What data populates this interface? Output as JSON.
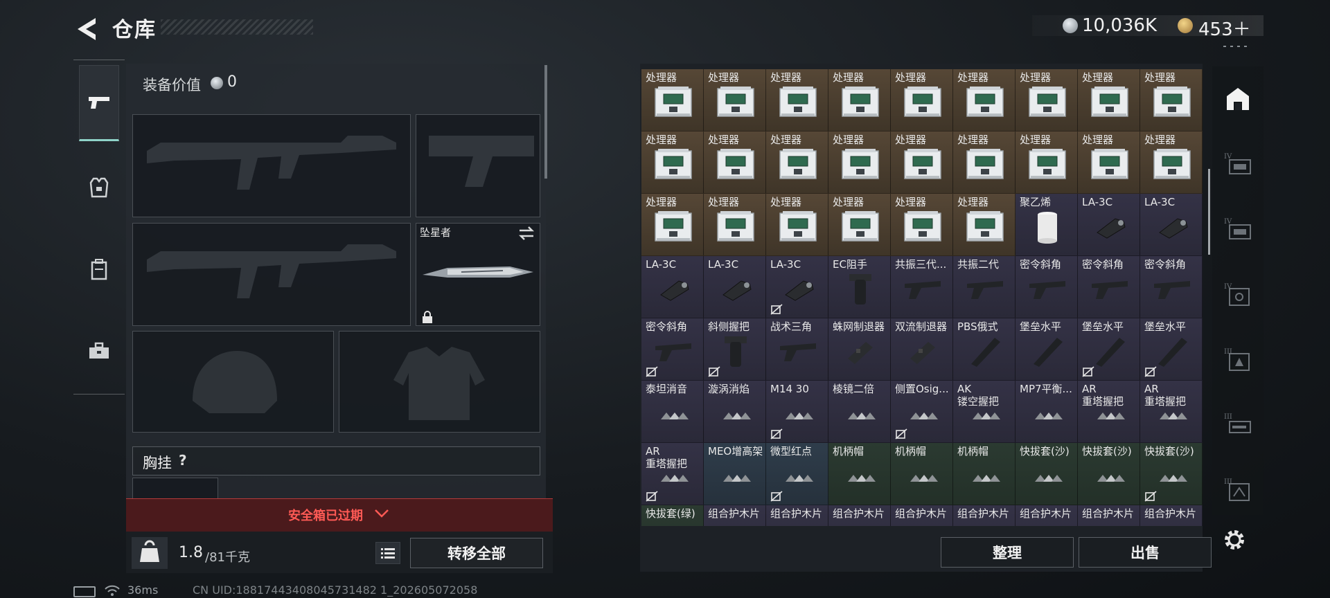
{
  "header": {
    "title": "仓库",
    "currency_a": "10,036K",
    "currency_b": "453＋"
  },
  "equipment": {
    "value_label": "装备价值",
    "value": "0",
    "melee_name": "坠星者",
    "chest_label": "胸挂",
    "chest_help": "?",
    "safebox_text": "安全箱已过期",
    "weight_value": "1.8",
    "weight_max": "/81千克",
    "transfer_all": "转移全部"
  },
  "inventory": {
    "rows": [
      [
        {
          "label": "处理器",
          "color": "brown",
          "icon": "processor-icon",
          "nosell": false
        },
        {
          "label": "处理器",
          "color": "brown",
          "icon": "processor-icon",
          "nosell": false
        },
        {
          "label": "处理器",
          "color": "brown",
          "icon": "processor-icon",
          "nosell": false
        },
        {
          "label": "处理器",
          "color": "brown",
          "icon": "processor-icon",
          "nosell": false
        },
        {
          "label": "处理器",
          "color": "brown",
          "icon": "processor-icon",
          "nosell": false
        },
        {
          "label": "处理器",
          "color": "brown",
          "icon": "processor-icon",
          "nosell": false
        },
        {
          "label": "处理器",
          "color": "brown",
          "icon": "processor-icon",
          "nosell": false
        },
        {
          "label": "处理器",
          "color": "brown",
          "icon": "processor-icon",
          "nosell": false
        },
        {
          "label": "处理器",
          "color": "brown",
          "icon": "processor-icon",
          "nosell": false
        }
      ],
      [
        {
          "label": "处理器",
          "color": "brown",
          "icon": "processor-icon",
          "nosell": false
        },
        {
          "label": "处理器",
          "color": "brown",
          "icon": "processor-icon",
          "nosell": false
        },
        {
          "label": "处理器",
          "color": "brown",
          "icon": "processor-icon",
          "nosell": false
        },
        {
          "label": "处理器",
          "color": "brown",
          "icon": "processor-icon",
          "nosell": false
        },
        {
          "label": "处理器",
          "color": "brown",
          "icon": "processor-icon",
          "nosell": false
        },
        {
          "label": "处理器",
          "color": "brown",
          "icon": "processor-icon",
          "nosell": false
        },
        {
          "label": "处理器",
          "color": "brown",
          "icon": "processor-icon",
          "nosell": false
        },
        {
          "label": "处理器",
          "color": "brown",
          "icon": "processor-icon",
          "nosell": false
        },
        {
          "label": "处理器",
          "color": "brown",
          "icon": "processor-icon",
          "nosell": false
        }
      ],
      [
        {
          "label": "处理器",
          "color": "brown",
          "icon": "processor-icon",
          "nosell": false
        },
        {
          "label": "处理器",
          "color": "brown",
          "icon": "processor-icon",
          "nosell": false
        },
        {
          "label": "处理器",
          "color": "brown",
          "icon": "processor-icon",
          "nosell": false
        },
        {
          "label": "处理器",
          "color": "brown",
          "icon": "processor-icon",
          "nosell": false
        },
        {
          "label": "处理器",
          "color": "brown",
          "icon": "processor-icon",
          "nosell": false
        },
        {
          "label": "处理器",
          "color": "brown",
          "icon": "processor-icon",
          "nosell": false
        },
        {
          "label": "聚乙烯",
          "color": "purple",
          "icon": "polyethylene-roll-icon",
          "nosell": false
        },
        {
          "label": "LA-3C",
          "color": "purple",
          "icon": "flashlight-icon",
          "nosell": false
        },
        {
          "label": "LA-3C",
          "color": "purple",
          "icon": "flashlight-icon",
          "nosell": false
        }
      ],
      [
        {
          "label": "LA-3C",
          "color": "purple",
          "icon": "flashlight-icon",
          "nosell": false
        },
        {
          "label": "LA-3C",
          "color": "purple",
          "icon": "flashlight-icon",
          "nosell": false
        },
        {
          "label": "LA-3C",
          "color": "purple",
          "icon": "flashlight-icon",
          "nosell": true
        },
        {
          "label": "EC阻手",
          "color": "purple",
          "icon": "grip-icon",
          "nosell": false
        },
        {
          "label": "共振三代...",
          "color": "purple",
          "icon": "angled-grip-icon",
          "nosell": false
        },
        {
          "label": "共振二代",
          "color": "purple",
          "icon": "angled-grip-icon",
          "nosell": false
        },
        {
          "label": "密令斜角",
          "color": "purple",
          "icon": "angled-grip-icon",
          "nosell": false
        },
        {
          "label": "密令斜角",
          "color": "purple",
          "icon": "angled-grip-icon",
          "nosell": false
        },
        {
          "label": "密令斜角",
          "color": "purple",
          "icon": "angled-grip-icon",
          "nosell": false
        }
      ],
      [
        {
          "label": "密令斜角",
          "color": "purple",
          "icon": "angled-grip-icon",
          "nosell": true
        },
        {
          "label": "斜侧握把",
          "color": "purple",
          "icon": "grip-icon",
          "nosell": true
        },
        {
          "label": "战术三角",
          "color": "purple",
          "icon": "angled-grip-icon",
          "nosell": false
        },
        {
          "label": "蛛网制退器",
          "color": "purple",
          "icon": "muzzle-brake-icon",
          "nosell": false
        },
        {
          "label": "双流制退器",
          "color": "purple",
          "icon": "muzzle-brake-icon",
          "nosell": false
        },
        {
          "label": "PBS俄式",
          "color": "purple",
          "icon": "suppressor-icon",
          "nosell": false
        },
        {
          "label": "堡垒水平",
          "color": "purple",
          "icon": "suppressor-icon",
          "nosell": false
        },
        {
          "label": "堡垒水平",
          "color": "purple",
          "icon": "suppressor-icon",
          "nosell": true
        },
        {
          "label": "堡垒水平",
          "color": "purple",
          "icon": "suppressor-icon",
          "nosell": true
        }
      ],
      [
        {
          "label": "泰坦消音",
          "color": "purple",
          "icon": "placeholder-triangles-icon",
          "nosell": false
        },
        {
          "label": "漩涡消焰",
          "color": "purple",
          "icon": "placeholder-triangles-icon",
          "nosell": false
        },
        {
          "label": "M14 30",
          "color": "purple",
          "icon": "placeholder-triangles-icon",
          "nosell": true
        },
        {
          "label": "棱镜二倍",
          "color": "purple",
          "icon": "placeholder-triangles-icon",
          "nosell": false
        },
        {
          "label": "侧置Osig...",
          "color": "purple",
          "icon": "placeholder-triangles-icon",
          "nosell": true
        },
        {
          "label": "AK\n镂空握把",
          "color": "purple",
          "icon": "placeholder-triangles-icon",
          "nosell": false
        },
        {
          "label": "MP7平衡...",
          "color": "purple",
          "icon": "placeholder-triangles-icon",
          "nosell": false
        },
        {
          "label": "AR\n重塔握把",
          "color": "purple",
          "icon": "placeholder-triangles-icon",
          "nosell": false
        },
        {
          "label": "AR\n重塔握把",
          "color": "purple",
          "icon": "placeholder-triangles-icon",
          "nosell": false
        }
      ],
      [
        {
          "label": "AR\n重塔握把",
          "color": "purple",
          "icon": "placeholder-triangles-icon",
          "nosell": true
        },
        {
          "label": "MEO增高架",
          "color": "blue",
          "icon": "placeholder-triangles-icon",
          "nosell": false
        },
        {
          "label": "微型红点",
          "color": "blue",
          "icon": "placeholder-triangles-icon",
          "nosell": true
        },
        {
          "label": "机柄帽",
          "color": "green",
          "icon": "placeholder-triangles-icon",
          "nosell": false
        },
        {
          "label": "机柄帽",
          "color": "green",
          "icon": "placeholder-triangles-icon",
          "nosell": false
        },
        {
          "label": "机柄帽",
          "color": "green",
          "icon": "placeholder-triangles-icon",
          "nosell": false
        },
        {
          "label": "快拔套(沙)",
          "color": "green",
          "icon": "placeholder-triangles-icon",
          "nosell": false
        },
        {
          "label": "快拔套(沙)",
          "color": "green",
          "icon": "placeholder-triangles-icon",
          "nosell": false
        },
        {
          "label": "快拔套(沙)",
          "color": "green",
          "icon": "placeholder-triangles-icon",
          "nosell": true
        }
      ],
      [
        {
          "label": "快拔套(绿)",
          "color": "green",
          "icon": "placeholder-triangles-icon",
          "nosell": false
        },
        {
          "label": "组合护木片",
          "color": "purple",
          "icon": "placeholder-triangles-icon",
          "nosell": false
        },
        {
          "label": "组合护木片",
          "color": "purple",
          "icon": "placeholder-triangles-icon",
          "nosell": false
        },
        {
          "label": "组合护木片",
          "color": "purple",
          "icon": "placeholder-triangles-icon",
          "nosell": false
        },
        {
          "label": "组合护木片",
          "color": "purple",
          "icon": "placeholder-triangles-icon",
          "nosell": false
        },
        {
          "label": "组合护木片",
          "color": "purple",
          "icon": "placeholder-triangles-icon",
          "nosell": false
        },
        {
          "label": "组合护木片",
          "color": "purple",
          "icon": "placeholder-triangles-icon",
          "nosell": false
        },
        {
          "label": "组合护木片",
          "color": "purple",
          "icon": "placeholder-triangles-icon",
          "nosell": false
        },
        {
          "label": "组合护木片",
          "color": "purple",
          "icon": "placeholder-triangles-icon",
          "nosell": false
        }
      ]
    ],
    "sort_label": "整理",
    "sell_label": "出售"
  },
  "status": {
    "ping": "36ms",
    "uid": "CN UID:18817443408045731482 1_202605072058"
  },
  "colors": {
    "accent": "#8fd3c8",
    "danger": "#ff5a55",
    "rarity_brown": "#564736",
    "rarity_purple": "#343246",
    "rarity_blue": "#2f3d4b",
    "rarity_green": "#2b3a31"
  }
}
